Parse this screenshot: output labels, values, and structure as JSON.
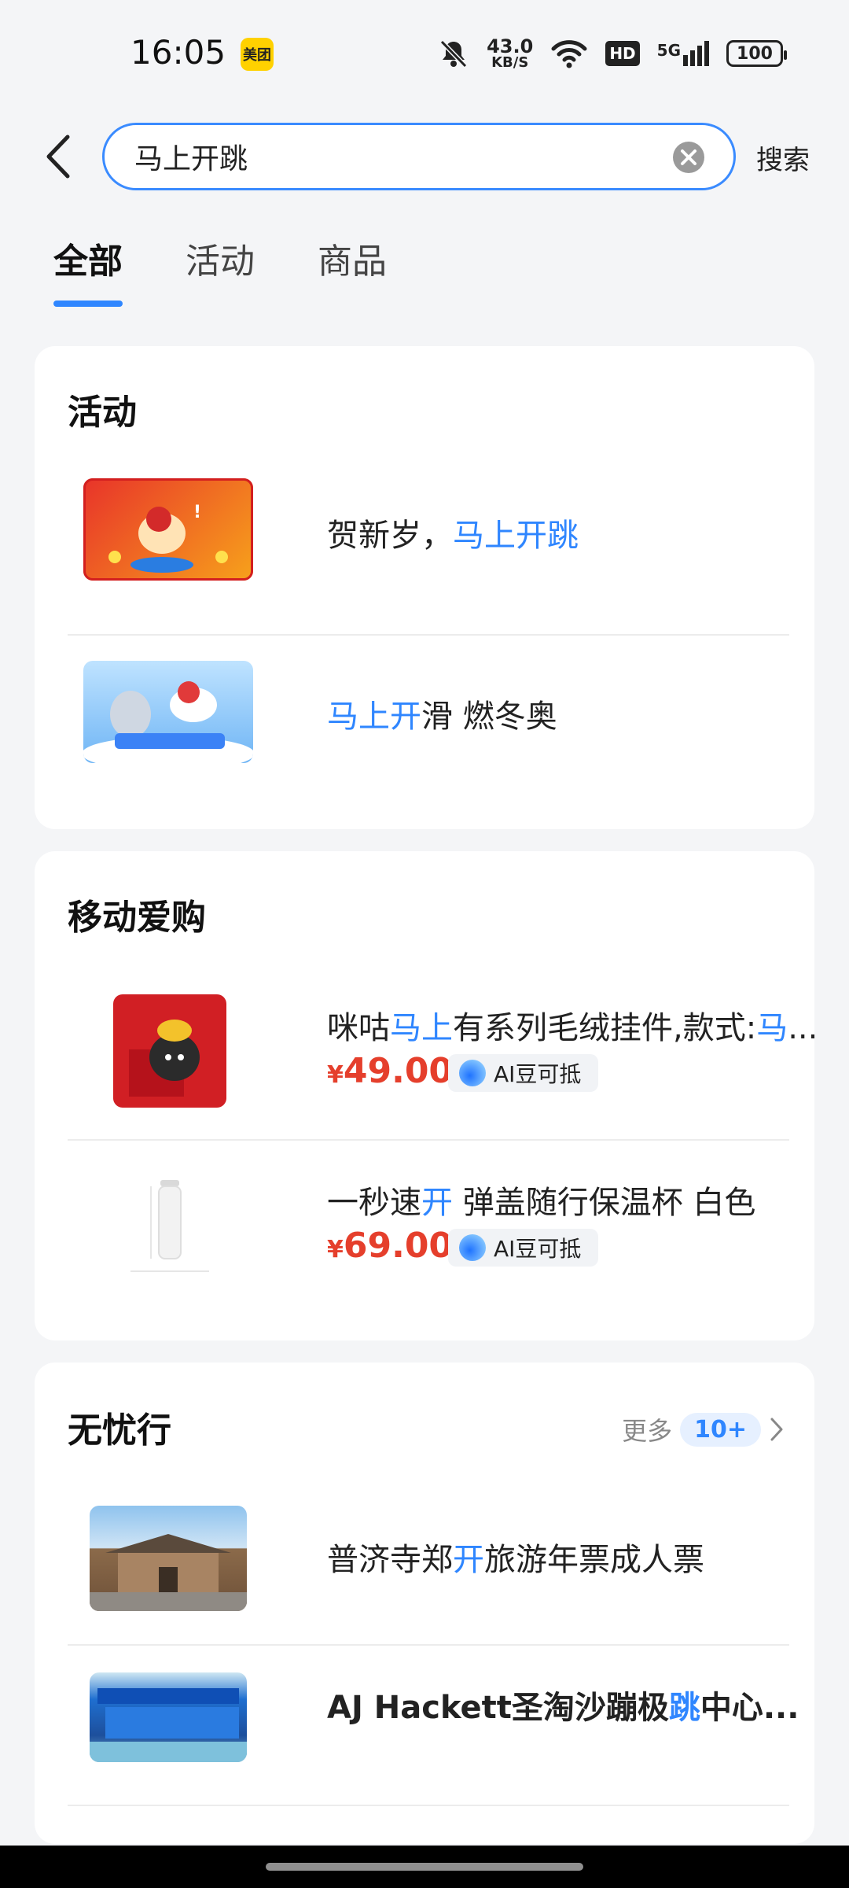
{
  "status_bar": {
    "time": "16:05",
    "app_badge": "美团",
    "net_speed_value": "43.0",
    "net_speed_unit": "KB/S",
    "hd": "HD",
    "network": "5G",
    "battery": "100"
  },
  "search": {
    "query": "马上开跳",
    "button_label": "搜索"
  },
  "tabs": [
    {
      "label": "全部",
      "active": true
    },
    {
      "label": "活动",
      "active": false
    },
    {
      "label": "商品",
      "active": false
    }
  ],
  "sections": {
    "activity": {
      "title": "活动",
      "items": [
        {
          "pre": "贺新岁，",
          "hl": "马上开跳",
          "post": ""
        },
        {
          "pre": "",
          "hl": "马上开",
          "post": "滑 燃冬奥"
        }
      ]
    },
    "shop": {
      "title": "移动爱购",
      "items": [
        {
          "pre": "咪咕",
          "hl": "马上",
          "mid": "有系列毛绒挂件,款式:",
          "hl2": "马",
          "post": "...",
          "price": "49.00",
          "tag": "AI豆可抵"
        },
        {
          "pre": "一秒速",
          "hl": "开",
          "mid": " 弹盖随行保温杯 白色",
          "hl2": "",
          "post": "",
          "price": "69.00",
          "tag": "AI豆可抵"
        }
      ],
      "currency": "¥"
    },
    "travel": {
      "title": "无忧行",
      "more_label": "更多",
      "more_count": "10+",
      "items": [
        {
          "pre": "普济寺郑",
          "hl": "开",
          "post": "旅游年票成人票"
        },
        {
          "pre": "AJ Hackett圣淘沙蹦极",
          "hl": "跳",
          "post": "中心..."
        }
      ]
    }
  },
  "colors": {
    "accent": "#2f86ff",
    "price": "#e53f2c",
    "background": "#f4f5f7"
  }
}
